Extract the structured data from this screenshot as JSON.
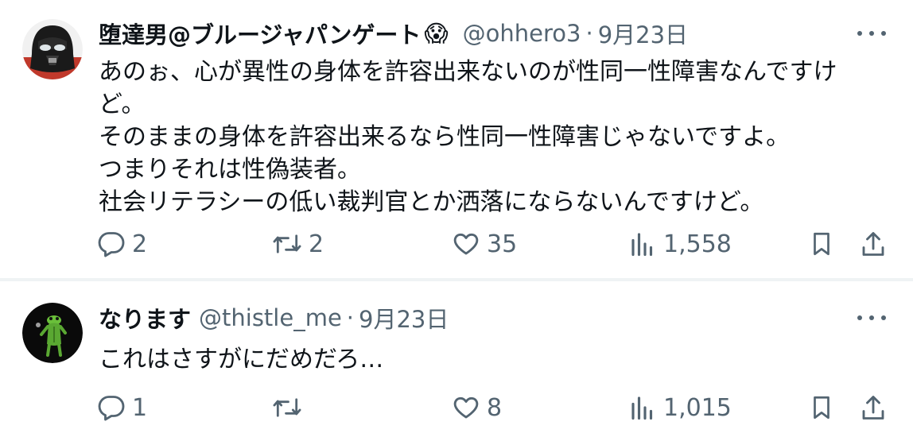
{
  "tweets": [
    {
      "name": "堕達男@ブルージャパンゲート",
      "emoji": "😱",
      "handle": "@ohhero3",
      "separator": "·",
      "date": "9月23日",
      "body": [
        "あのぉ、心が異性の身体を許容出来ないのが性同一性障害なんですけ",
        "ど。",
        "そのままの身体を許容出来るなら性同一性障害じゃないですよ。",
        "つまりそれは性偽装者。",
        "社会リテラシーの低い裁判官とか洒落にならないんですけど。"
      ],
      "replies": "2",
      "retweets": "2",
      "likes": "35",
      "views": "1,558"
    },
    {
      "name": "なります",
      "handle": "@thistle_me",
      "separator": "·",
      "date": "9月23日",
      "body": [
        "これはさすがにだめだろ…"
      ],
      "replies": "1",
      "retweets": "",
      "likes": "8",
      "views": "1,015"
    }
  ],
  "colors": {
    "text_primary": "#0f1419",
    "text_secondary": "#536471",
    "divider": "#eff3f4",
    "background": "#ffffff"
  },
  "icons": [
    "more-icon",
    "reply-icon",
    "retweet-icon",
    "like-icon",
    "views-icon",
    "bookmark-icon",
    "share-icon"
  ]
}
